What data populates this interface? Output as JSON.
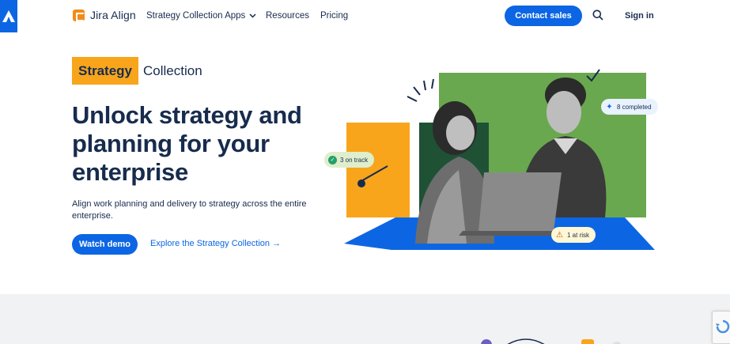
{
  "header": {
    "logo_text": "Jira Align",
    "nav": {
      "apps_label": "Strategy Collection Apps",
      "resources_label": "Resources",
      "pricing_label": "Pricing"
    },
    "contact_label": "Contact sales",
    "signin_label": "Sign in"
  },
  "hero": {
    "badge_highlight": "Strategy",
    "badge_text": "Collection",
    "headline": "Unlock strategy and planning for your enterprise",
    "subtext": "Align work planning and delivery to strategy across the entire enterprise.",
    "watch_label": "Watch demo",
    "explore_label": "Explore the Strategy Collection →"
  },
  "art": {
    "pill_on_track": "3 on track",
    "pill_completed": "8 completed",
    "pill_at_risk": "1 at risk"
  },
  "colors": {
    "brand_blue": "#0c66e4",
    "orange": "#f8a51c",
    "green": "#6aa84f",
    "dark_green": "#1f5135",
    "band_gray": "#f1f2f4"
  },
  "icons": [
    "atlassian-logo-icon",
    "jira-align-logo-icon",
    "chevron-down-icon",
    "search-icon",
    "check-circle-icon",
    "sparkle-icon",
    "warning-icon",
    "recaptcha-icon"
  ]
}
